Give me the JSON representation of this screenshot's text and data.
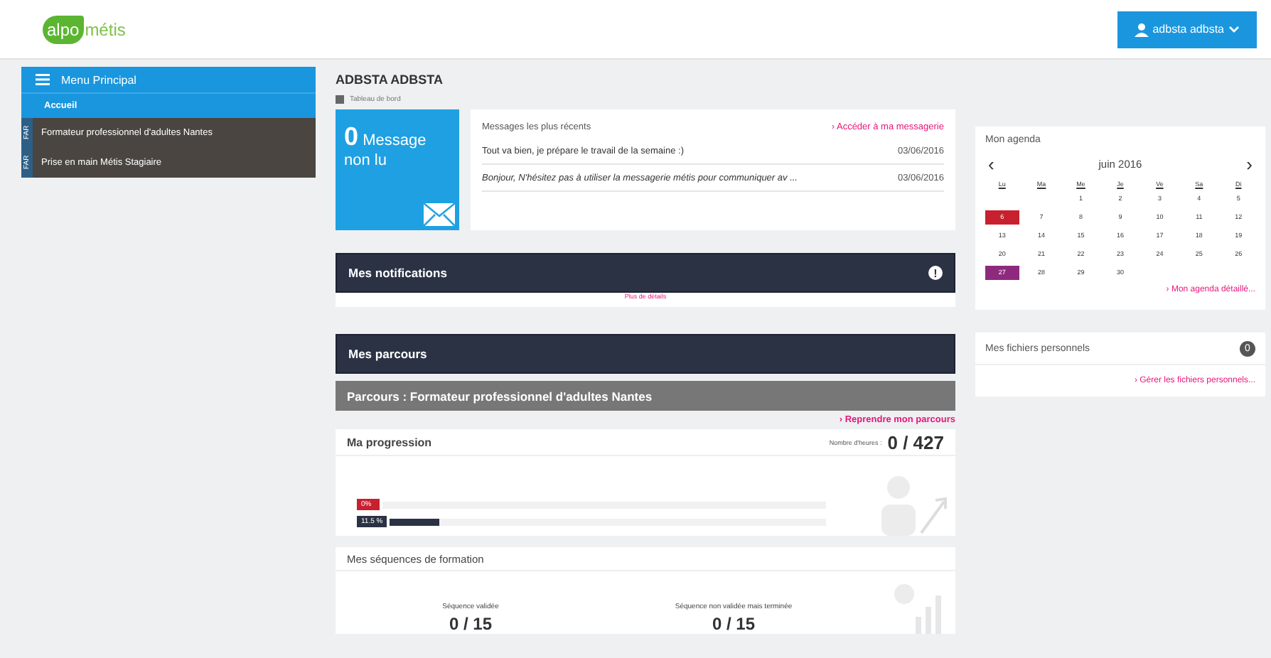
{
  "header": {
    "logo_left": "alpo",
    "logo_right": "métis",
    "user_button": "adbsta adbsta"
  },
  "sidebar": {
    "title": "Menu Principal",
    "items": [
      {
        "label": "Accueil",
        "selected": true
      },
      {
        "label": "Formateur professionnel d'adultes Nantes",
        "tag": "FAR",
        "selected": false
      },
      {
        "label": "Prise en main Métis Stagiaire",
        "tag": "FAR",
        "selected": false
      }
    ]
  },
  "page": {
    "title": "ADBSTA ADBSTA",
    "breadcrumb": "Tableau de bord"
  },
  "messages": {
    "count": "0",
    "count_label": "Message",
    "count_label2": "non lu",
    "heading": "Messages les plus récents",
    "link": "› Accéder à ma messagerie",
    "rows": [
      {
        "text": "Tout va bien, je prépare le travail de la semaine :)",
        "date": "03/06/2016",
        "italic": false
      },
      {
        "text": "Bonjour, N'hésitez pas à utiliser la messagerie métis pour communiquer av ...",
        "date": "03/06/2016",
        "italic": true
      }
    ]
  },
  "notifications": {
    "title": "Mes notifications",
    "badge": "!",
    "link": "Plus de détails"
  },
  "parcours": {
    "title": "Mes parcours",
    "subtitle": "Parcours : Formateur professionnel d'adultes Nantes",
    "link": "› Reprendre mon parcours"
  },
  "progression": {
    "title": "Ma progression",
    "hours_label": "Nombre d'heures :",
    "hours": "0 / 427",
    "bars": [
      {
        "label": "0%",
        "level": 0,
        "color": "#c8202f"
      },
      {
        "label": "11.5 %",
        "level": 0.115,
        "color": "#2b3244"
      }
    ]
  },
  "sequences": {
    "title": "Mes séquences de formation",
    "stats": [
      {
        "label": "Séquence validée",
        "value": "0 / 15"
      },
      {
        "label": "Séquence non validée mais terminée",
        "value": "0 / 15"
      }
    ]
  },
  "agenda": {
    "title": "Mon agenda",
    "prev": "‹",
    "month": "juin 2016",
    "next": "›",
    "weekdays": [
      "Lu",
      "Ma",
      "Me",
      "Je",
      "Ve",
      "Sa",
      "Di"
    ],
    "weeks": [
      {
        "kind": "leading",
        "days": [
          {
            "day": "1"
          },
          {
            "day": "2"
          },
          {
            "day": "3"
          },
          {
            "day": "4"
          },
          {
            "day": "5"
          }
        ]
      },
      {
        "kind": "full",
        "days": [
          {
            "day": "6",
            "color": "#c8202f"
          },
          {
            "day": "7"
          },
          {
            "day": "8"
          },
          {
            "day": "9"
          },
          {
            "day": "10"
          },
          {
            "day": "11"
          },
          {
            "day": "12"
          }
        ]
      },
      {
        "kind": "full",
        "days": [
          {
            "day": "13"
          },
          {
            "day": "14"
          },
          {
            "day": "15"
          },
          {
            "day": "16"
          },
          {
            "day": "17"
          },
          {
            "day": "18"
          },
          {
            "day": "19"
          }
        ]
      },
      {
        "kind": "full",
        "days": [
          {
            "day": "20"
          },
          {
            "day": "21"
          },
          {
            "day": "22"
          },
          {
            "day": "23"
          },
          {
            "day": "24"
          },
          {
            "day": "25"
          },
          {
            "day": "26"
          }
        ]
      },
      {
        "kind": "trailing",
        "days": [
          {
            "day": "27",
            "color": "#8e2a7e"
          },
          {
            "day": "28"
          },
          {
            "day": "29"
          },
          {
            "day": "30"
          }
        ]
      }
    ],
    "link": "› Mon agenda détaillé..."
  },
  "files": {
    "title": "Mes fichiers personnels",
    "count": "0",
    "link": "› Gérer les fichiers personnels..."
  }
}
